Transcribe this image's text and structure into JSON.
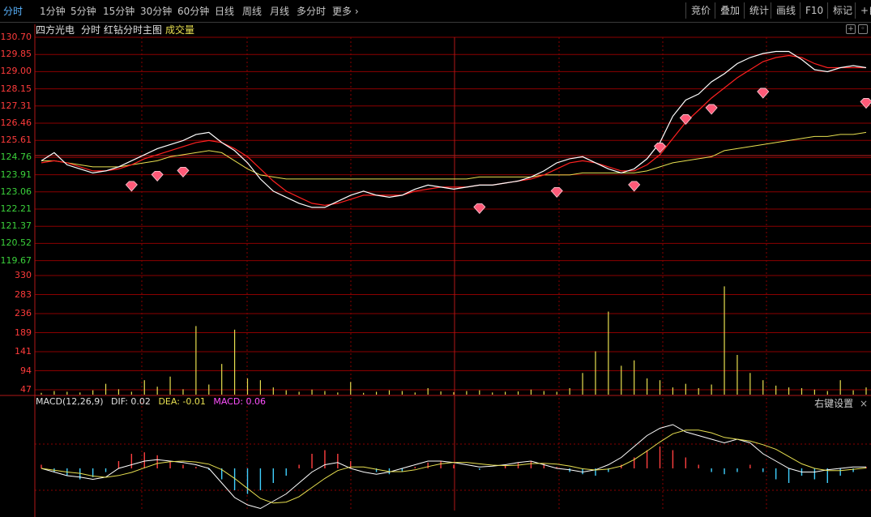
{
  "toolbar": {
    "periods": [
      "分时",
      "1分钟",
      "5分钟",
      "15分钟",
      "30分钟",
      "60分钟",
      "日线",
      "周线",
      "月线",
      "多分时",
      "更多"
    ],
    "more_arrow": "›",
    "right_buttons": [
      "竞价",
      "叠加",
      "统计",
      "画线",
      "F10",
      "标记",
      "+自"
    ]
  },
  "subheader": {
    "stock_name": "四方光电",
    "mode": "分时",
    "indicator": "红钻分时主图",
    "volume_label": "成交量"
  },
  "price_axis": [
    "130.70",
    "129.85",
    "129.00",
    "128.15",
    "127.31",
    "126.46",
    "125.61",
    "124.76",
    "123.91",
    "123.06",
    "122.21",
    "121.37",
    "120.52",
    "119.67"
  ],
  "volume_axis": [
    "330",
    "283",
    "236",
    "189",
    "141",
    "94",
    "47"
  ],
  "macd": {
    "title": "MACD(12,26,9)",
    "dif": "DIF: 0.02",
    "dea": "DEA: -0.01",
    "macd": "MACD: 0.06",
    "settings": "右键设置",
    "close_icon": "×"
  },
  "colors": {
    "price_line": "#ffffff",
    "ma_red": "#ff2020",
    "avg_yellow": "#e8e050",
    "grid": "#8b0000",
    "axis_red": "#ff3b3b",
    "axis_green": "#3bd13b",
    "macd_pos": "#ff4040",
    "macd_neg": "#40d0ff"
  },
  "chart_data": {
    "type": "line",
    "title": "四方光电 分时",
    "price_ylim": [
      119.67,
      130.7
    ],
    "volume_ylim": [
      0,
      330
    ],
    "series": [
      {
        "name": "price",
        "values": [
          124.6,
          125.0,
          124.4,
          124.2,
          124.0,
          124.1,
          124.3,
          124.6,
          124.9,
          125.2,
          125.4,
          125.6,
          125.9,
          126.0,
          125.5,
          125.1,
          124.5,
          123.7,
          123.1,
          122.8,
          122.5,
          122.3,
          122.3,
          122.6,
          122.9,
          123.1,
          122.9,
          122.8,
          122.9,
          123.2,
          123.4,
          123.3,
          123.2,
          123.3,
          123.4,
          123.4,
          123.5,
          123.6,
          123.8,
          124.1,
          124.5,
          124.7,
          124.8,
          124.5,
          124.2,
          124.0,
          124.2,
          124.7,
          125.5,
          126.8,
          127.6,
          127.9,
          128.5,
          128.9,
          129.4,
          129.7,
          129.9,
          130.0,
          130.0,
          129.6,
          129.1,
          129.0,
          129.2,
          129.3,
          129.2
        ],
        "start": 0
      },
      {
        "name": "ma",
        "values": [
          124.5,
          124.6,
          124.5,
          124.3,
          124.1,
          124.1,
          124.2,
          124.4,
          124.7,
          124.9,
          125.1,
          125.3,
          125.5,
          125.6,
          125.5,
          125.2,
          124.8,
          124.2,
          123.6,
          123.1,
          122.8,
          122.5,
          122.4,
          122.5,
          122.7,
          122.9,
          122.9,
          122.9,
          122.9,
          123.1,
          123.2,
          123.3,
          123.3,
          123.3,
          123.4,
          123.4,
          123.5,
          123.6,
          123.7,
          123.9,
          124.2,
          124.5,
          124.6,
          124.5,
          124.3,
          124.1,
          124.1,
          124.4,
          124.9,
          125.7,
          126.5,
          127.1,
          127.7,
          128.2,
          128.7,
          129.1,
          129.5,
          129.7,
          129.8,
          129.7,
          129.4,
          129.2,
          129.2,
          129.2,
          129.2
        ],
        "start": 0
      },
      {
        "name": "avg",
        "values": [
          124.6,
          124.6,
          124.5,
          124.4,
          124.3,
          124.3,
          124.3,
          124.4,
          124.5,
          124.6,
          124.8,
          124.9,
          125.0,
          125.1,
          125.0,
          124.6,
          124.2,
          123.9,
          123.8,
          123.7,
          123.7,
          123.7,
          123.7,
          123.7,
          123.7,
          123.7,
          123.7,
          123.7,
          123.7,
          123.7,
          123.7,
          123.7,
          123.7,
          123.7,
          123.8,
          123.8,
          123.8,
          123.8,
          123.8,
          123.9,
          123.9,
          123.9,
          124.0,
          124.0,
          124.0,
          124.0,
          124.0,
          124.1,
          124.3,
          124.5,
          124.6,
          124.7,
          124.8,
          125.1,
          125.2,
          125.3,
          125.4,
          125.5,
          125.6,
          125.7,
          125.8,
          125.8,
          125.9,
          125.9,
          126.0
        ],
        "start": 0
      },
      {
        "name": "diamonds",
        "values": [
          [
            7,
            123.3
          ],
          [
            9,
            123.8
          ],
          [
            11,
            124.0
          ],
          [
            34,
            122.2
          ],
          [
            40,
            123.0
          ],
          [
            46,
            123.3
          ],
          [
            48,
            125.2
          ],
          [
            50,
            126.6
          ],
          [
            52,
            127.1
          ],
          [
            56,
            127.9
          ],
          [
            64,
            127.4
          ]
        ]
      }
    ],
    "volume": [
      5,
      10,
      8,
      6,
      12,
      30,
      15,
      8,
      40,
      22,
      50,
      15,
      190,
      28,
      85,
      180,
      45,
      40,
      20,
      12,
      8,
      14,
      10,
      6,
      35,
      5,
      8,
      12,
      10,
      6,
      18,
      9,
      7,
      10,
      12,
      6,
      8,
      9,
      14,
      10,
      8,
      18,
      60,
      120,
      230,
      80,
      95,
      45,
      40,
      20,
      30,
      18,
      28,
      300,
      110,
      60,
      40,
      25,
      20,
      18,
      14,
      10,
      40,
      12,
      20
    ],
    "macd_hist": [
      0.05,
      -0.05,
      -0.1,
      -0.15,
      -0.12,
      -0.05,
      0.1,
      0.2,
      0.22,
      0.18,
      0.1,
      0.05,
      0.02,
      -0.02,
      -0.15,
      -0.3,
      -0.35,
      -0.3,
      -0.2,
      -0.1,
      0.05,
      0.2,
      0.25,
      0.2,
      0.1,
      0.0,
      -0.05,
      -0.08,
      -0.05,
      0.02,
      0.08,
      0.1,
      0.05,
      0.0,
      -0.02,
      0.0,
      0.05,
      0.08,
      0.1,
      0.06,
      0.02,
      -0.05,
      -0.08,
      -0.1,
      -0.05,
      0.05,
      0.15,
      0.25,
      0.3,
      0.25,
      0.15,
      0.05,
      -0.05,
      -0.08,
      -0.05,
      0.05,
      -0.05,
      -0.15,
      -0.2,
      -0.1,
      -0.15,
      -0.2,
      -0.1,
      -0.05,
      0.02
    ],
    "macd_dif": [
      0.0,
      -0.05,
      -0.1,
      -0.12,
      -0.15,
      -0.12,
      0.0,
      0.05,
      0.1,
      0.12,
      0.1,
      0.08,
      0.05,
      0.0,
      -0.2,
      -0.4,
      -0.5,
      -0.55,
      -0.45,
      -0.35,
      -0.2,
      -0.05,
      0.05,
      0.08,
      0.0,
      -0.05,
      -0.08,
      -0.05,
      0.0,
      0.05,
      0.1,
      0.1,
      0.08,
      0.05,
      0.02,
      0.03,
      0.05,
      0.08,
      0.1,
      0.05,
      0.0,
      -0.02,
      -0.05,
      -0.02,
      0.05,
      0.15,
      0.3,
      0.45,
      0.55,
      0.6,
      0.5,
      0.45,
      0.4,
      0.35,
      0.4,
      0.35,
      0.2,
      0.1,
      0.0,
      -0.05,
      -0.05,
      -0.02,
      0.0,
      0.02,
      0.02
    ]
  }
}
